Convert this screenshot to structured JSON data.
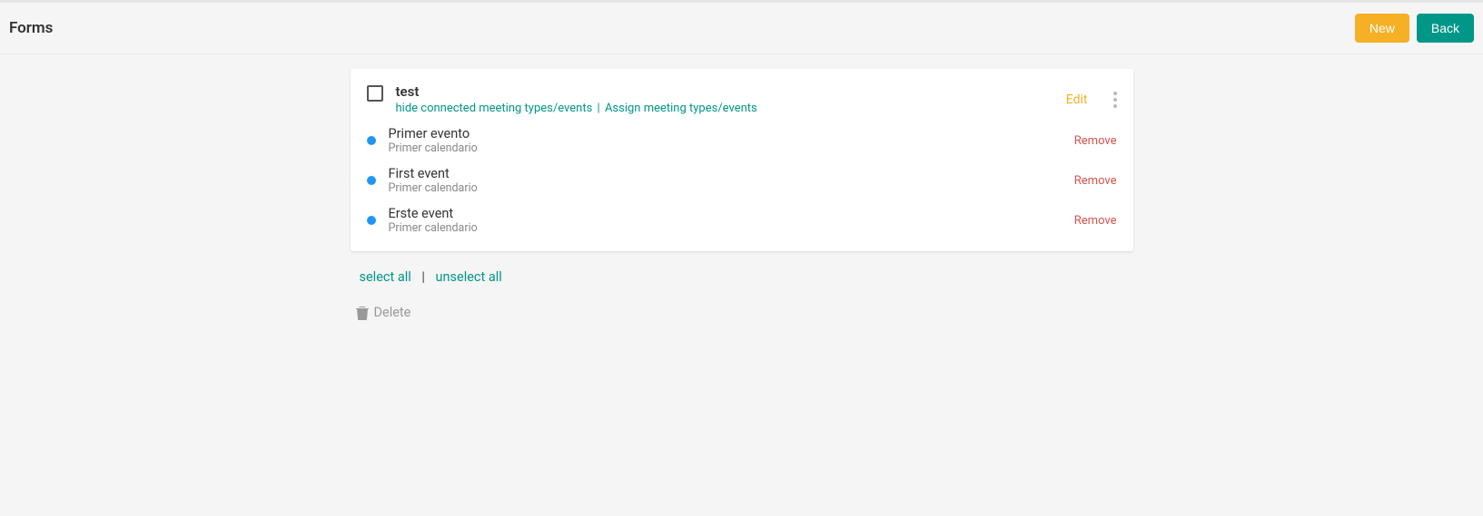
{
  "header": {
    "title": "Forms",
    "new_label": "New",
    "back_label": "Back"
  },
  "card": {
    "title": "test",
    "hide_link": "hide connected meeting types/events",
    "assign_link": "Assign meeting types/events",
    "edit_label": "Edit",
    "events": [
      {
        "name": "Primer evento",
        "calendar": "Primer calendario",
        "remove": "Remove"
      },
      {
        "name": "First event",
        "calendar": "Primer calendario",
        "remove": "Remove"
      },
      {
        "name": "Erste event",
        "calendar": "Primer calendario",
        "remove": "Remove"
      }
    ]
  },
  "actions": {
    "select_all": "select all",
    "separator": "|",
    "unselect_all": "unselect all",
    "delete": "Delete"
  }
}
